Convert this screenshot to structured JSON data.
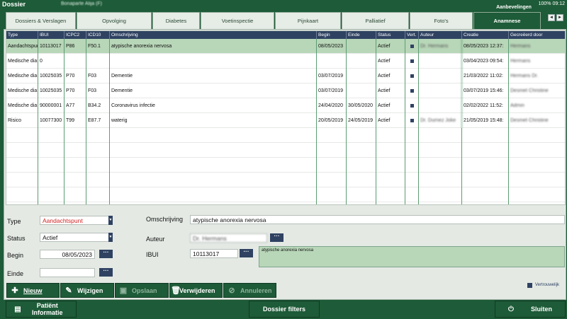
{
  "window": {
    "title": "Dossier",
    "patient": "Bonaparte Alija (F)",
    "status_text": "100% 09:12"
  },
  "tabs": [
    {
      "label": "Dossiers & Verslagen"
    },
    {
      "label": "Opvolging"
    },
    {
      "label": "Diabetes"
    },
    {
      "label": "Voetinspectie"
    },
    {
      "label": "Pijnkaart"
    },
    {
      "label": "Palliatief"
    },
    {
      "label": "Foto's"
    },
    {
      "label": "Anamnese"
    }
  ],
  "tab_bubble": "Aanbevelingen",
  "nav": {
    "prev": "◄",
    "next": "►"
  },
  "grid": {
    "columns": [
      "Type",
      "IBUI",
      "ICPC2",
      "ICD10",
      "Omschrijving",
      "Begin",
      "Einde",
      "Status",
      "Vert.",
      "Auteur",
      "Creatie",
      "Gecreëerd door"
    ],
    "rows": [
      {
        "type": "Aandachtspunt",
        "ibui": "10113017",
        "icpc2": "P86",
        "icd10": "F50.1",
        "omschrijving": "atypische anorexia nervosa",
        "begin": "08/05/2023",
        "einde": "",
        "status": "Actief",
        "vert": true,
        "auteur": "Dr. Hermans",
        "creatie": "08/05/2023 12:37:",
        "door": "Hermans"
      },
      {
        "type": "Medische dia",
        "ibui": "0",
        "icpc2": "",
        "icd10": "",
        "omschrijving": "",
        "begin": "",
        "einde": "",
        "status": "Actief",
        "vert": true,
        "auteur": "",
        "creatie": "03/04/2023 09:54:",
        "door": "Hermans"
      },
      {
        "type": "Medische dia",
        "ibui": "10025035",
        "icpc2": "P70",
        "icd10": "F03",
        "omschrijving": "Dementie",
        "begin": "03/07/2019",
        "einde": "",
        "status": "Actief",
        "vert": true,
        "auteur": "",
        "creatie": "21/03/2022 11:02:",
        "door": "Hermans Dr."
      },
      {
        "type": "Medische dia",
        "ibui": "10025035",
        "icpc2": "P70",
        "icd10": "F03",
        "omschrijving": "Dementie",
        "begin": "03/07/2019",
        "einde": "",
        "status": "Actief",
        "vert": true,
        "auteur": "",
        "creatie": "03/07/2019 15:46:",
        "door": "Desmet Christine"
      },
      {
        "type": "Medische dia",
        "ibui": "90000001",
        "icpc2": "A77",
        "icd10": "B34.2",
        "omschrijving": "Coronavirus infectie",
        "begin": "24/04/2020",
        "einde": "30/05/2020",
        "status": "Actief",
        "vert": true,
        "auteur": "",
        "creatie": "02/02/2022 11:52:",
        "door": "Admin"
      },
      {
        "type": "Risico",
        "ibui": "10077300",
        "icpc2": "T99",
        "icd10": "E87.7",
        "omschrijving": "waterig",
        "begin": "20/05/2019",
        "einde": "24/05/2019",
        "status": "Actief",
        "vert": true,
        "auteur": "Dr. Durnez Joke",
        "creatie": "21/05/2019 15:48:",
        "door": "Desmet Christine"
      }
    ]
  },
  "form": {
    "type_label": "Type",
    "type_value": "Aandachtspunt",
    "status_label": "Status",
    "status_value": "Actief",
    "begin_label": "Begin",
    "begin_value": "08/05/2023",
    "einde_label": "Einde",
    "einde_value": "",
    "omschrijving_label": "Omschrijving",
    "omschrijving_value": "atypische anorexia nervosa",
    "auteur_label": "Auteur",
    "auteur_value": "Dr. Hermans",
    "ibui_label": "IBUI",
    "ibui_value": "10113017",
    "memo_value": "atypische anorexia nervosa",
    "dots": "···",
    "dropdown": "▼"
  },
  "legend": {
    "label": "Vertrouwelijk"
  },
  "actions": {
    "nieuw": "Nieuw",
    "wijzigen": "Wijzigen",
    "opslaan": "Opslaan",
    "verwijderen": "Verwijderen",
    "annuleren": "Annuleren"
  },
  "footer": {
    "patient_info": "Patiënt Informatie",
    "dossier_filters": "Dossier filters",
    "sluiten": "Sluiten"
  },
  "colors": {
    "brand_green": "#1e5b38",
    "header_navy": "#2f4262",
    "selected_row": "#b8d6b8",
    "type_red": "#d02020"
  }
}
